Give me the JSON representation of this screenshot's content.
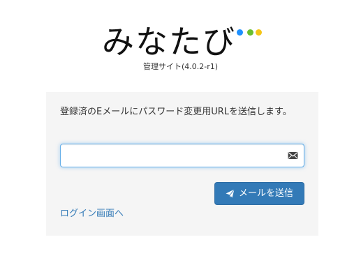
{
  "header": {
    "logo_text": "みなたび",
    "logo_dot_colors": [
      "#1e90ff",
      "#6abf2e",
      "#f5c518"
    ],
    "subtitle": "管理サイト(4.0.2-r1)"
  },
  "form": {
    "instructions": "登録済のEメールにパスワード変更用URLを送信します。",
    "email_value": "",
    "email_icon": "envelope-icon",
    "send_label": "メールを送信",
    "send_icon": "paper-plane-icon"
  },
  "footer": {
    "login_link": "ログイン画面へ"
  },
  "colors": {
    "accent": "#337ab7",
    "card_background": "#f5f5f5",
    "input_focus_border": "#66afe9"
  }
}
